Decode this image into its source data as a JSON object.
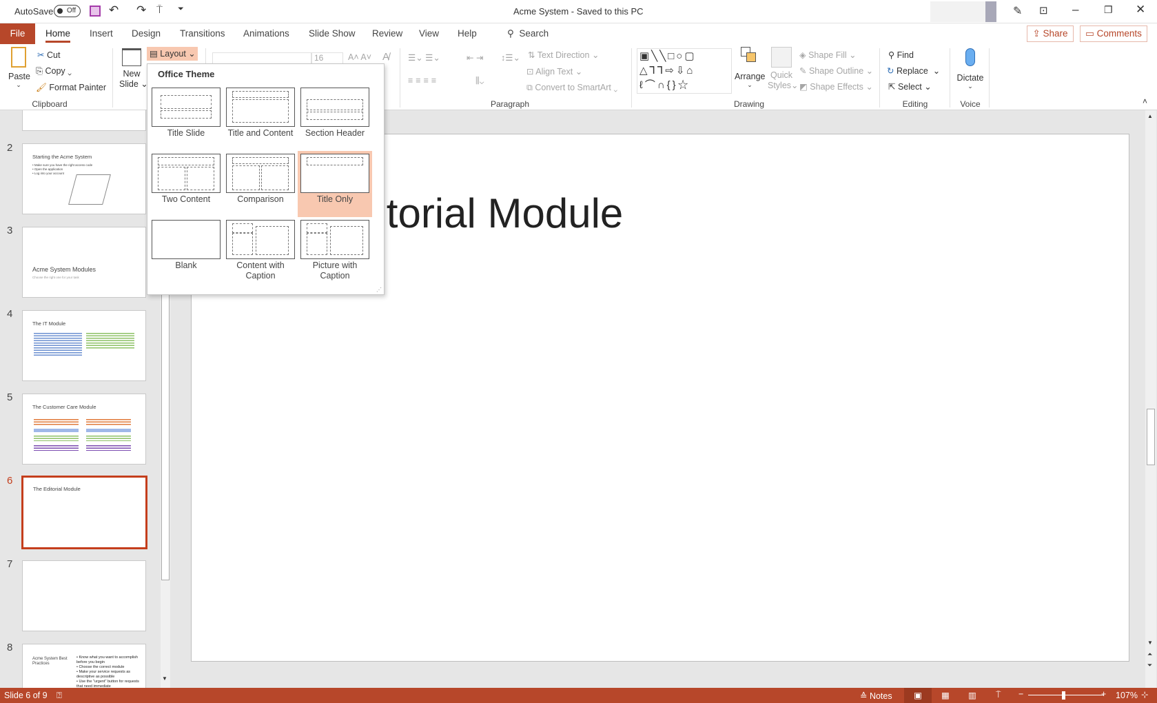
{
  "titlebar": {
    "autosave_label": "AutoSave",
    "autosave_state": "Off",
    "document_title": "Acme System  -  Saved to this PC"
  },
  "tabs": [
    "File",
    "Home",
    "Insert",
    "Design",
    "Transitions",
    "Animations",
    "Slide Show",
    "Review",
    "View",
    "Help"
  ],
  "search_label": "Search",
  "share_label": "Share",
  "comments_label": "Comments",
  "ribbon": {
    "clipboard": {
      "paste": "Paste",
      "cut": "Cut",
      "copy": "Copy",
      "format_painter": "Format Painter",
      "label": "Clipboard"
    },
    "slides": {
      "new_slide": "New",
      "new_slide2": "Slide",
      "layout": "Layout"
    },
    "font": {
      "size": "16"
    },
    "paragraph": {
      "text_direction": "Text Direction",
      "align_text": "Align Text",
      "convert_smartart": "Convert to SmartArt",
      "label": "Paragraph"
    },
    "drawing": {
      "arrange": "Arrange",
      "quick_styles": "Quick",
      "quick_styles2": "Styles",
      "shape_fill": "Shape Fill",
      "shape_outline": "Shape Outline",
      "shape_effects": "Shape Effects",
      "label": "Drawing"
    },
    "editing": {
      "find": "Find",
      "replace": "Replace",
      "select": "Select",
      "label": "Editing"
    },
    "voice": {
      "dictate": "Dictate",
      "label": "Voice"
    }
  },
  "layout_menu": {
    "header": "Office Theme",
    "selected": "Title Only",
    "items": [
      "Title Slide",
      "Title and Content",
      "Section Header",
      "Two Content",
      "Comparison",
      "Title Only",
      "Blank",
      "Content with Caption",
      "Picture with Caption"
    ]
  },
  "thumbnails": [
    {
      "num": "2",
      "title": "Starting the Acme System",
      "bullets": [
        "• Make sure you have the right access code",
        "• Open the application",
        "• Log into your account"
      ]
    },
    {
      "num": "3",
      "title": "Acme System Modules",
      "subtitle": "Choose the right one for your task"
    },
    {
      "num": "4",
      "title": "The IT Module"
    },
    {
      "num": "5",
      "title": "The Customer Care Module"
    },
    {
      "num": "6",
      "title": "The Editorial Module"
    },
    {
      "num": "7",
      "title": ""
    },
    {
      "num": "8",
      "title": "Acme System Best Practices",
      "bullets": [
        "• Know what you want to accomplish before you begin",
        "• Choose the correct module",
        "• Make your service requests as descriptive as possible",
        "• Use the \"urgent\" button for requests that need immediate"
      ]
    }
  ],
  "slide": {
    "title": "The Editorial Module"
  },
  "status": {
    "slide_info": "Slide 6 of 9",
    "notes": "Notes",
    "zoom": "107%"
  },
  "colors": {
    "accent": "#b7472a",
    "selected_layout": "#f8c8b0"
  }
}
